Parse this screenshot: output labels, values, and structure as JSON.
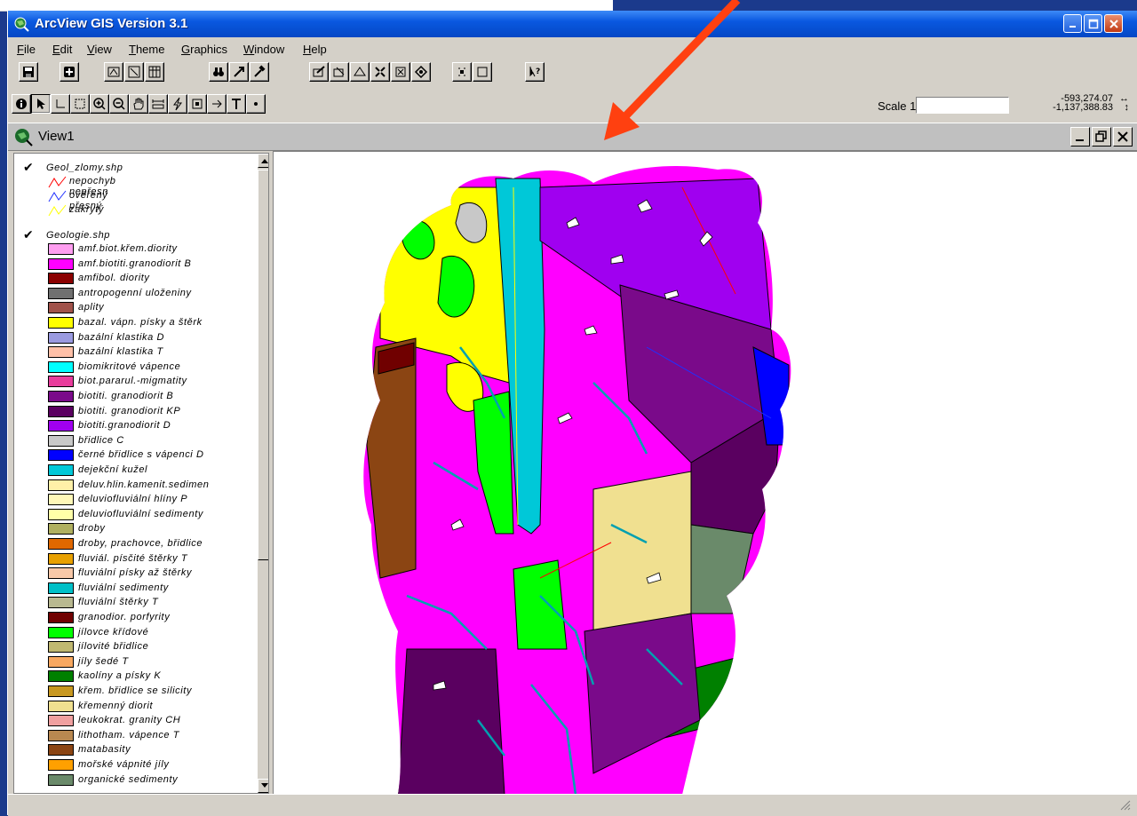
{
  "window": {
    "title": "ArcView GIS Version 3.1"
  },
  "menu": [
    "File",
    "Edit",
    "View",
    "Theme",
    "Graphics",
    "Window",
    "Help"
  ],
  "toolbar": {
    "scale_label": "Scale 1:",
    "scale_value": "",
    "coord_x": "-593,274.07",
    "coord_y": "-1,137,388.83"
  },
  "view": {
    "title": "View1"
  },
  "toc": {
    "theme1": {
      "name": "Geol_zlomy.shp",
      "items": [
        {
          "label": "nepochyb nepřesn",
          "color": "#ff0000"
        },
        {
          "label": "ověřený přesný",
          "color": "#2030ff"
        },
        {
          "label": "zakrytý",
          "color": "#ffff00"
        }
      ]
    },
    "theme2": {
      "name": "Geologie.shp",
      "items": [
        {
          "label": "amf.biot.křem.diority",
          "color": "#ff9ef0"
        },
        {
          "label": "amf.biotiti.granodiorit B",
          "color": "#ff00ff"
        },
        {
          "label": "amfibol. diority",
          "color": "#8b0000"
        },
        {
          "label": "antropogenní uloženiny",
          "color": "#707070"
        },
        {
          "label": "aplity",
          "color": "#a0524a"
        },
        {
          "label": "bazal. vápn. písky a štěrk",
          "color": "#ffff00"
        },
        {
          "label": "bazální klastika D",
          "color": "#9a9ae0"
        },
        {
          "label": "bazální klastika T",
          "color": "#ffc0a8"
        },
        {
          "label": "biomikritové vápence",
          "color": "#00ffff"
        },
        {
          "label": "biot.pararul.-migmatity",
          "color": "#e83c9c"
        },
        {
          "label": "biotiti. granodiorit B",
          "color": "#7a0a8a"
        },
        {
          "label": "biotiti. granodiorit KP",
          "color": "#5a0060"
        },
        {
          "label": "biotiti.granodiorit D",
          "color": "#a000f0"
        },
        {
          "label": "břidlice C",
          "color": "#c8c8c8"
        },
        {
          "label": "černé břidlice s vápenci D",
          "color": "#0000ff"
        },
        {
          "label": "dejekční kužel",
          "color": "#00c8d8"
        },
        {
          "label": "deluv.hlin.kamenit.sedimen",
          "color": "#fff0a8"
        },
        {
          "label": "deluviofluviální hlíny P",
          "color": "#fff8b8"
        },
        {
          "label": "deluviofluviální sedimenty",
          "color": "#ffffa8"
        },
        {
          "label": "droby",
          "color": "#b0b060"
        },
        {
          "label": "droby, prachovce, břidlice",
          "color": "#e06800"
        },
        {
          "label": "fluviál. písčité štěrky T",
          "color": "#e8a000"
        },
        {
          "label": "fluviální písky až štěrky",
          "color": "#f8c8a8"
        },
        {
          "label": "fluviální sedimenty",
          "color": "#00c0c8"
        },
        {
          "label": "fluviální štěrky T",
          "color": "#b8b890"
        },
        {
          "label": "granodior. porfyrity",
          "color": "#700000"
        },
        {
          "label": "jílovce křídové",
          "color": "#00ff00"
        },
        {
          "label": "jílovité břidlice",
          "color": "#c0b870"
        },
        {
          "label": "jíly šedé T",
          "color": "#f8a860"
        },
        {
          "label": "kaolíny a písky K",
          "color": "#008000"
        },
        {
          "label": "křem. břidlice se silicity",
          "color": "#c89820"
        },
        {
          "label": "křemenný diorit",
          "color": "#f0e090"
        },
        {
          "label": "leukokrat. granity CH",
          "color": "#f0a0a0"
        },
        {
          "label": "lithotham. vápence T",
          "color": "#b88850"
        },
        {
          "label": "matabasity",
          "color": "#8b4513"
        },
        {
          "label": "mořské vápnité jíly",
          "color": "#ffa000"
        },
        {
          "label": "organické sedimenty",
          "color": "#6a8a6a"
        }
      ]
    }
  }
}
